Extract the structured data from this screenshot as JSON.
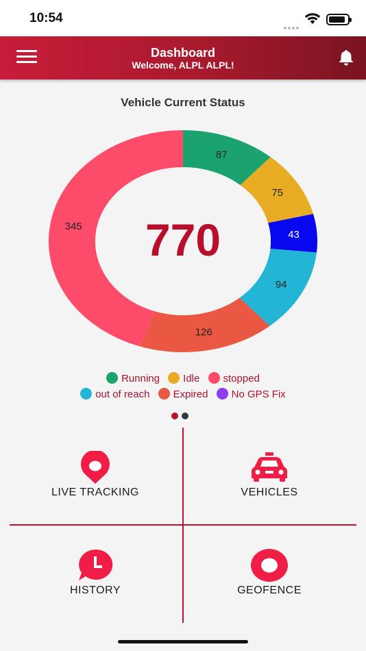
{
  "status": {
    "time": "10:54",
    "battery_level": 0.9
  },
  "header": {
    "title": "Dashboard",
    "subtitle": "Welcome, ALPL ALPL!"
  },
  "section_title": "Vehicle Current Status",
  "colors": {
    "brand": "#c0112d",
    "running": "#1aa36f",
    "idle": "#e8ac24",
    "stopped": "#fd4b6a",
    "out_of_reach": "#22b5d5",
    "expired": "#ea5844",
    "no_gps_fix": "#8c3ef0"
  },
  "chart_data": {
    "type": "pie",
    "title": "Vehicle Current Status",
    "total": "770",
    "segments": [
      {
        "name": "Running",
        "value": 87,
        "color": "#1aa36f"
      },
      {
        "name": "Idle",
        "value": 75,
        "color": "#e8ac24"
      },
      {
        "name": "",
        "value": 43,
        "color": "#0707f0"
      },
      {
        "name": "out of reach",
        "value": 94,
        "color": "#22b5d5"
      },
      {
        "name": "Expired",
        "value": 126,
        "color": "#ea5844"
      },
      {
        "name": "stopped",
        "value": 345,
        "color": "#fd4b6a"
      }
    ]
  },
  "legend": [
    {
      "label": "Running",
      "color": "#1aa36f"
    },
    {
      "label": "Idle",
      "color": "#e8ac24"
    },
    {
      "label": "stopped",
      "color": "#fd4b6a"
    },
    {
      "label": "out of reach",
      "color": "#22b5d5"
    },
    {
      "label": "Expired",
      "color": "#ea5844"
    },
    {
      "label": "No GPS Fix",
      "color": "#8c3ef0"
    }
  ],
  "pager": {
    "active": 0,
    "count": 2
  },
  "tiles": {
    "live_tracking": {
      "label": "LIVE TRACKING",
      "icon": "location-pin-icon"
    },
    "vehicles": {
      "label": "VEHICLES",
      "icon": "car-icon"
    },
    "history": {
      "label": "HISTORY",
      "icon": "clock-bubble-icon"
    },
    "geofence": {
      "label": "GEOFENCE",
      "icon": "geofence-ring-icon"
    }
  }
}
